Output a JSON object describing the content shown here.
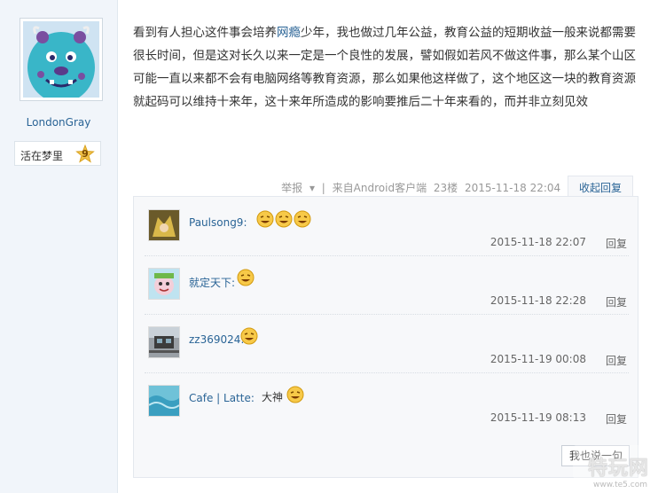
{
  "author": {
    "name": "LondonGray",
    "rank_title": "活在梦里",
    "rank_level": "9"
  },
  "post": {
    "text_before": "看到有人担心这件事会培养",
    "keyword": "网瘾",
    "text_after": "少年，我也做过几年公益，教育公益的短期收益一般来说都需要很长时间，但是这对长久以来一定是一个良性的发展，譬如假如若风不做这件事，那么某个山区可能一直以来都不会有电脑网络等教育资源，那么如果他这样做了，这个地区这一块的教育资源就起码可以维持十来年，这十来年所造成的影响要推后二十年来看的，而并非立刻见效"
  },
  "post_tail": {
    "report": "举报",
    "separator": "|",
    "client": "来自Android客户端",
    "floor": "23楼",
    "time": "2015-11-18 22:04",
    "toggle": "收起回复"
  },
  "comments": [
    {
      "user": "Paulsong9:",
      "content": "",
      "emoji_count": 3,
      "time": "2015-11-18 22:07",
      "reply": "回复"
    },
    {
      "user": "就定天下:",
      "content": "",
      "emoji_count": 1,
      "time": "2015-11-18 22:28",
      "reply": "回复"
    },
    {
      "user": "zz369024:",
      "content": "",
      "emoji_count": 1,
      "time": "2015-11-19 00:08",
      "reply": "回复"
    },
    {
      "user": "Cafe | Latte:",
      "content": "大神",
      "emoji_count": 1,
      "time": "2015-11-19 08:13",
      "reply": "回复"
    }
  ],
  "reply_box": {
    "label": "我也说一句"
  },
  "watermark": {
    "logo": "特玩网",
    "url": "www.te5.com"
  },
  "colors": {
    "link": "#2a6496",
    "left_bg": "#f1f5fa",
    "comments_bg": "#f7f8fa"
  }
}
